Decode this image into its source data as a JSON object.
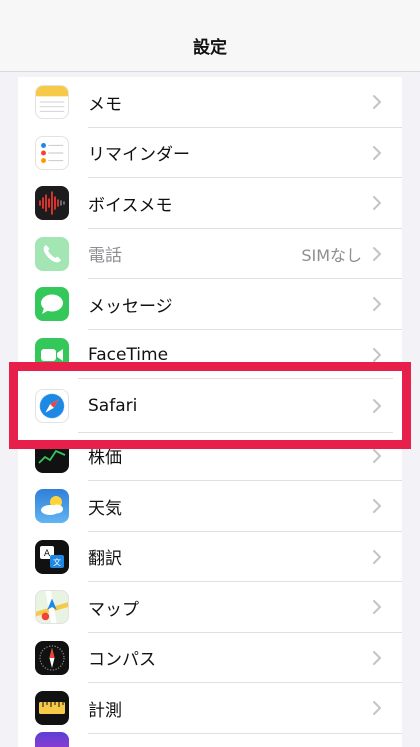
{
  "navbar": {
    "title": "設定"
  },
  "rows": [
    {
      "label": "メモ",
      "icon": "notes-icon"
    },
    {
      "label": "リマインダー",
      "icon": "reminders-icon"
    },
    {
      "label": "ボイスメモ",
      "icon": "voice-memos-icon"
    },
    {
      "label": "電話",
      "value": "SIMなし",
      "icon": "phone-icon",
      "disabled": true
    },
    {
      "label": "メッセージ",
      "icon": "messages-icon"
    },
    {
      "label": "FaceTime",
      "icon": "facetime-icon"
    },
    {
      "label": "株価",
      "icon": "stocks-icon"
    },
    {
      "label": "天気",
      "icon": "weather-icon"
    },
    {
      "label": "翻訳",
      "icon": "translate-icon"
    },
    {
      "label": "マップ",
      "icon": "maps-icon"
    },
    {
      "label": "コンパス",
      "icon": "compass-icon"
    },
    {
      "label": "計測",
      "icon": "measure-icon"
    }
  ],
  "highlighted": {
    "label": "Safari",
    "icon": "safari-icon",
    "outline_color": "#e6204a"
  },
  "colors": {
    "accent": "#e6204a",
    "phone_green": "#34c759",
    "messages_green": "#34c759",
    "safari_blue": "#1e88e5"
  }
}
